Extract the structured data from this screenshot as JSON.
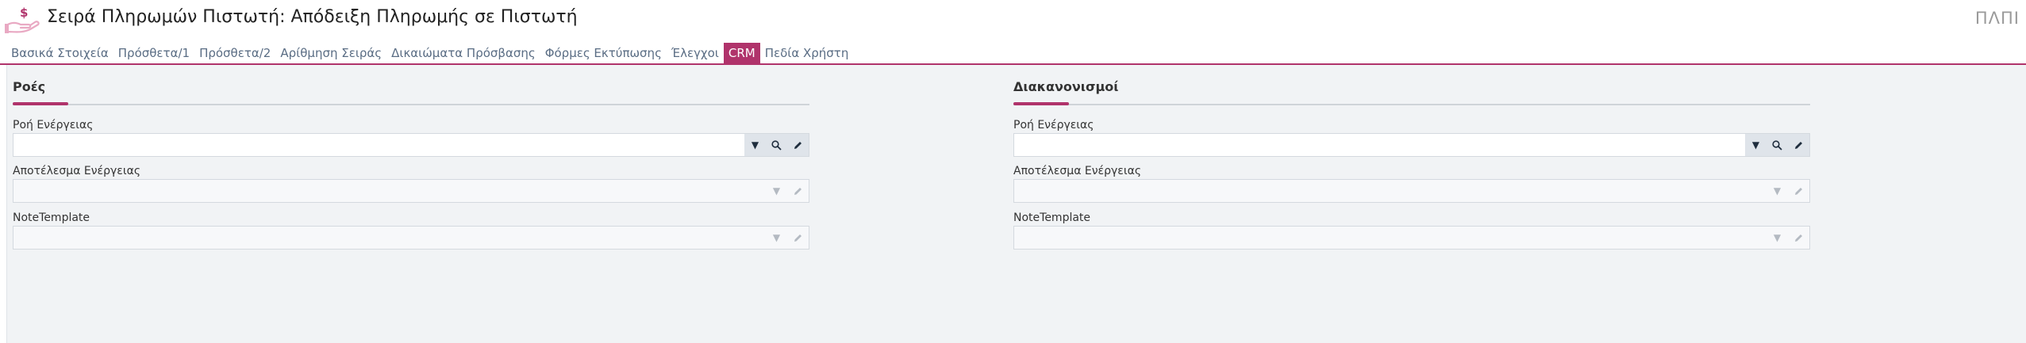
{
  "header": {
    "title": "Σειρά Πληρωμών Πιστωτή: Απόδειξη Πληρωμής σε Πιστωτή",
    "brand": "ΠΛΠΙ",
    "icon": "money-hand-icon",
    "accent_color": "#b0336b"
  },
  "tabs": [
    {
      "label": "Βασικά Στοιχεία",
      "active": false
    },
    {
      "label": "Πρόσθετα/1",
      "active": false
    },
    {
      "label": "Πρόσθετα/2",
      "active": false
    },
    {
      "label": "Αρίθμηση Σειράς",
      "active": false
    },
    {
      "label": "Δικαιώματα Πρόσβασης",
      "active": false
    },
    {
      "label": "Φόρμες Εκτύπωσης",
      "active": false
    },
    {
      "label": "Έλεγχοι",
      "active": false
    },
    {
      "label": "CRM",
      "active": true
    },
    {
      "label": "Πεδία Χρήστη",
      "active": false
    }
  ],
  "sections": {
    "flows": {
      "title": "Ροές",
      "fields": [
        {
          "label": "Ροή Ενέργειας",
          "value": "",
          "enabled": true
        },
        {
          "label": "Αποτέλεσμα Ενέργειας",
          "value": "",
          "enabled": false
        },
        {
          "label": "NoteTemplate",
          "value": "",
          "enabled": false
        }
      ]
    },
    "settlements": {
      "title": "Διακανονισμοί",
      "fields": [
        {
          "label": "Ροή Ενέργειας",
          "value": "",
          "enabled": true
        },
        {
          "label": "Αποτέλεσμα Ενέργειας",
          "value": "",
          "enabled": false
        },
        {
          "label": "NoteTemplate",
          "value": "",
          "enabled": false
        }
      ]
    }
  }
}
